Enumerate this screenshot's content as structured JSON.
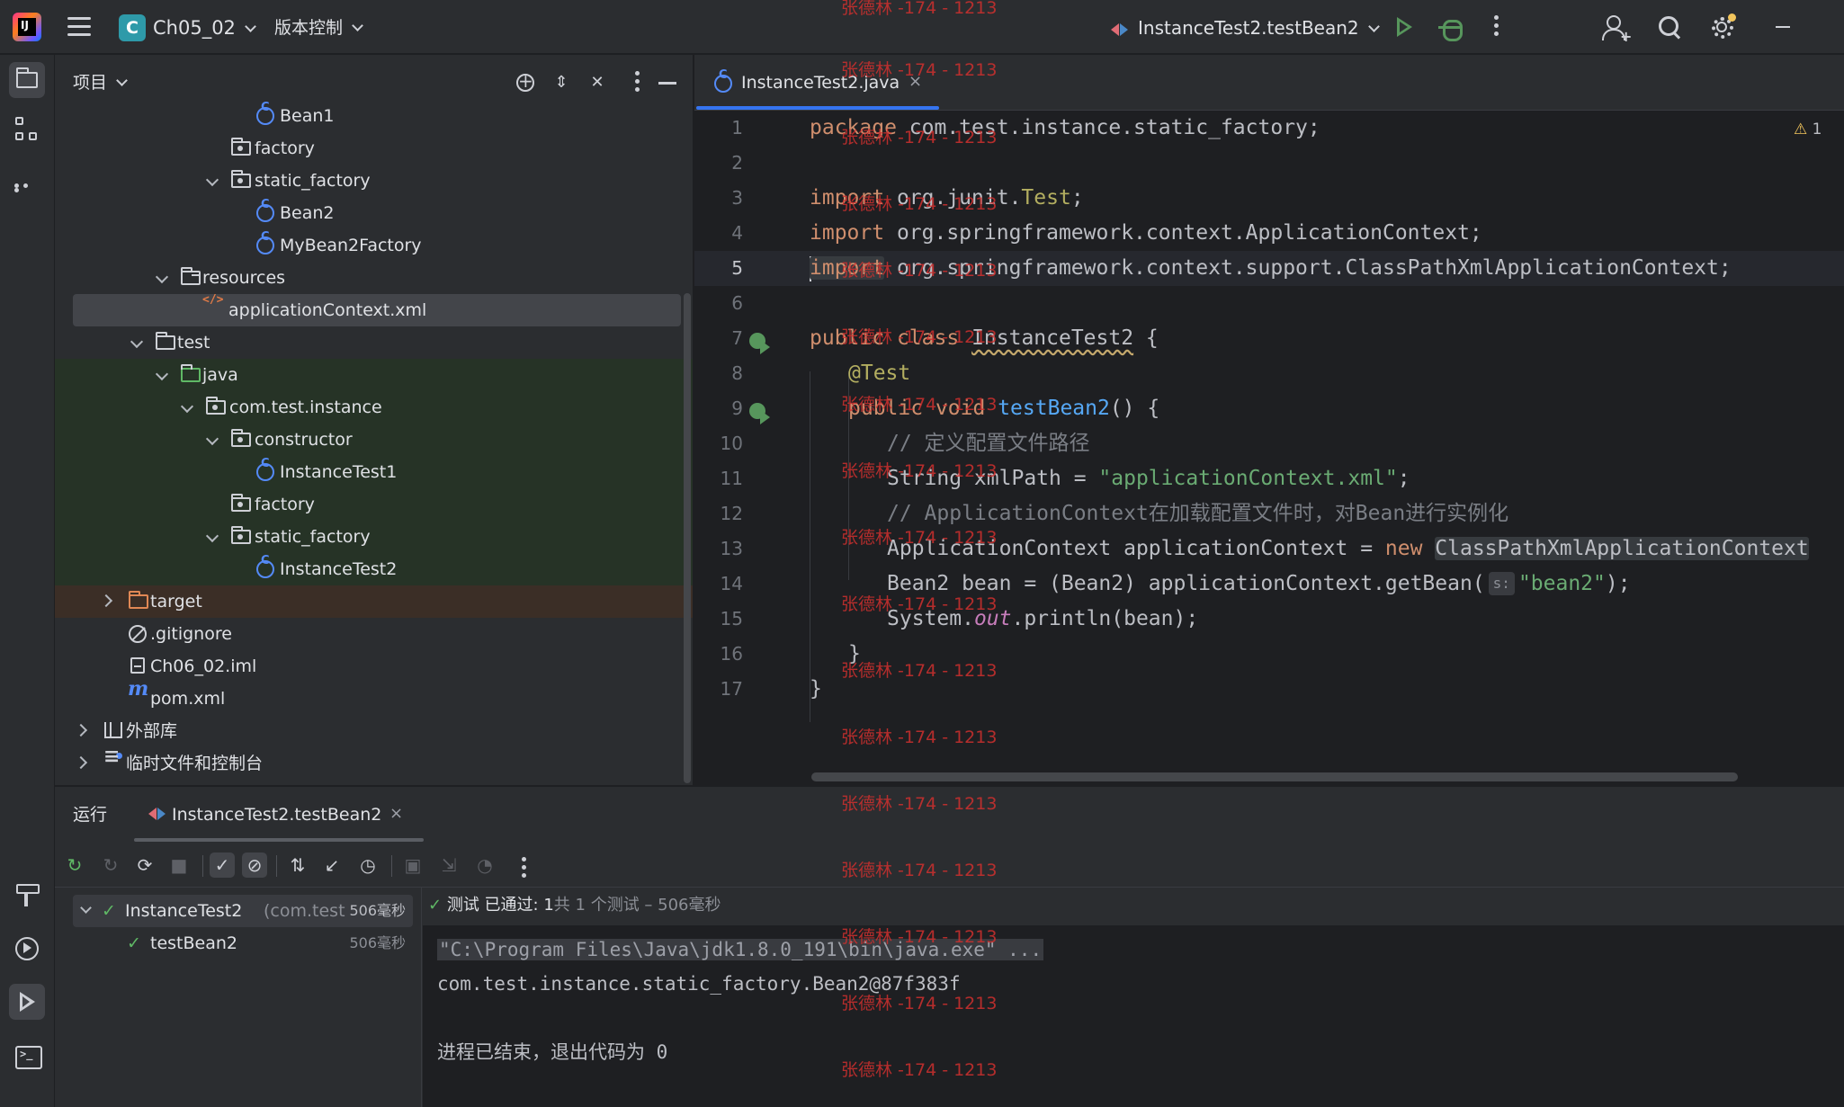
{
  "topbar": {
    "app_logo_text": "IJ",
    "project_badge": "C",
    "project_name": "Ch05_02",
    "vcs_label": "版本控制",
    "run_config": "InstanceTest2.testBean2",
    "icons": [
      "hamburger-menu-icon",
      "run-icon",
      "debug-icon",
      "more-actions-icon",
      "add-user-icon",
      "search-icon",
      "settings-icon",
      "minimize-icon"
    ]
  },
  "left_strip": {
    "icons": [
      "project-folder-icon",
      "structure-icon",
      "more-tools-icon",
      "build-icon",
      "services-icon",
      "run-tool-icon",
      "terminal-icon"
    ]
  },
  "project_panel": {
    "title": "项目",
    "header_icons": [
      "locate-file-icon",
      "expand-all-icon",
      "collapse-all-icon",
      "options-icon",
      "hide-icon"
    ],
    "tree": [
      {
        "label": "Bean1",
        "icon": "class-icon"
      },
      {
        "label": "factory",
        "icon": "package-icon"
      },
      {
        "label": "static_factory",
        "icon": "package-icon",
        "expanded": true
      },
      {
        "label": "Bean2",
        "icon": "class-icon"
      },
      {
        "label": "MyBean2Factory",
        "icon": "class-icon"
      },
      {
        "label": "resources",
        "icon": "resources-folder-icon",
        "expanded": true
      },
      {
        "label": "applicationContext.xml",
        "icon": "xml-file-icon",
        "selected": true
      },
      {
        "label": "test",
        "icon": "folder-icon",
        "expanded": true
      },
      {
        "label": "java",
        "icon": "test-folder-icon",
        "expanded": true
      },
      {
        "label": "com.test.instance",
        "icon": "package-icon",
        "expanded": true
      },
      {
        "label": "constructor",
        "icon": "package-icon",
        "expanded": true
      },
      {
        "label": "InstanceTest1",
        "icon": "class-icon"
      },
      {
        "label": "factory",
        "icon": "package-icon"
      },
      {
        "label": "static_factory",
        "icon": "package-icon",
        "expanded": true
      },
      {
        "label": "InstanceTest2",
        "icon": "class-icon"
      },
      {
        "label": "target",
        "icon": "excluded-folder-icon",
        "expanded": false
      },
      {
        "label": ".gitignore",
        "icon": "ignore-file-icon"
      },
      {
        "label": "Ch06_02.iml",
        "icon": "iml-file-icon"
      },
      {
        "label": "pom.xml",
        "icon": "maven-icon"
      },
      {
        "label": "外部库",
        "icon": "library-icon",
        "expanded": false
      },
      {
        "label": "临时文件和控制台",
        "icon": "scratches-icon",
        "expanded": false
      }
    ]
  },
  "editor": {
    "tab_label": "InstanceTest2.java",
    "tab_close": "×",
    "warning_icon": "⚠",
    "warning_count": "1",
    "current_line": 5,
    "line_numbers": [
      "1",
      "2",
      "3",
      "4",
      "5",
      "6",
      "7",
      "8",
      "9",
      "10",
      "11",
      "12",
      "13",
      "14",
      "15",
      "16",
      "17"
    ],
    "lines": {
      "l1_kw": "package",
      "l1_rest": " com.test.instance.static_factory;",
      "l3_kw": "import",
      "l3_pkg": " org.junit.",
      "l3_cls": "Test",
      "l3_end": ";",
      "l4_kw": "import",
      "l4_rest": " org.springframework.context.ApplicationContext;",
      "l5_kw": "import",
      "l5_rest": " org.springframework.context.support.ClassPathXmlApplicationContext;",
      "l7_kw1": "public",
      "l7_kw2": "class",
      "l7_name": "InstanceTest2",
      "l7_end": " {",
      "l8_ann": "@Test",
      "l9_kw1": "public",
      "l9_kw2": "void",
      "l9_fn": "testBean2",
      "l9_end": "() {",
      "l10_cmt": "// 定义配置文件路径",
      "l11_pre": "String xmlPath = ",
      "l11_str": "\"applicationContext.xml\"",
      "l11_end": ";",
      "l12_cmt": "// ApplicationContext在加载配置文件时，对Bean进行实例化",
      "l13_pre": "ApplicationContext applicationContext = ",
      "l13_kw": "new",
      "l13_cls": "ClassPathXmlApplicationContext",
      "l14_pre": "Bean2 bean = (Bean2) applicationContext.getBean(",
      "l14_hint": "s:",
      "l14_str": "\"bean2\"",
      "l14_end": ");",
      "l15_pre": "System.",
      "l15_out": "out",
      "l15_end": ".println(bean);",
      "l16": "}",
      "l17": "}"
    }
  },
  "run_panel": {
    "title": "运行",
    "tab_label": "InstanceTest2.testBean2",
    "tab_close": "×",
    "toolbar_icons": [
      "rerun-icon",
      "rerun-failed-icon",
      "toggle-auto-test-icon",
      "stop-icon",
      "show-passed-icon",
      "show-ignored-icon",
      "sort-icon",
      "collapse-icon",
      "history-icon",
      "export-icon",
      "import-icon",
      "coverage-icon",
      "more-icon"
    ],
    "test_tree": [
      {
        "name": "InstanceTest2",
        "pkg": "(com.test.i",
        "duration": "506毫秒"
      },
      {
        "name": "testBean2",
        "duration": "506毫秒"
      }
    ],
    "status_prefix": "测试 已通过: 1",
    "status_suffix": "共 1 个测试 – 506毫秒",
    "console": {
      "cmd": "\"C:\\Program Files\\Java\\jdk1.8.0_191\\bin\\java.exe\" ...",
      "output": "com.test.instance.static_factory.Bean2@87f383f",
      "exit": "进程已结束，退出代码为 0"
    }
  },
  "watermark": "张德林 -174 - 1213",
  "colors": {
    "accent": "#3574f0",
    "success": "#5fb865",
    "watermark": "#d0302e"
  }
}
